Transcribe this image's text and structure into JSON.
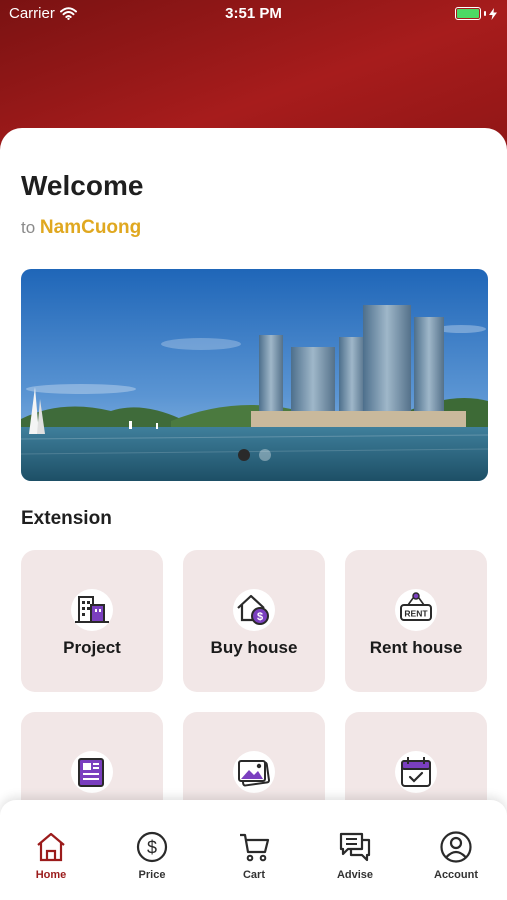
{
  "status_bar": {
    "carrier": "Carrier",
    "time": "3:51 PM"
  },
  "welcome": {
    "title": "Welcome",
    "prefix": "to",
    "brand": "NamCuong"
  },
  "banner": {
    "image": "coastal-towers-photo",
    "slide_count": 2,
    "active_slide": 1
  },
  "extension": {
    "title": "Extension",
    "tiles": [
      {
        "label": "Project",
        "icon": "building-icon"
      },
      {
        "label": "Buy house",
        "icon": "house-dollar-icon"
      },
      {
        "label": "Rent house",
        "icon": "rent-sign-icon"
      },
      {
        "label": "",
        "icon": "news-icon"
      },
      {
        "label": "",
        "icon": "gallery-icon"
      },
      {
        "label": "",
        "icon": "calendar-check-icon"
      }
    ]
  },
  "tabbar": {
    "tabs": [
      {
        "label": "Home",
        "icon": "home-icon",
        "active": true
      },
      {
        "label": "Price",
        "icon": "dollar-circle-icon",
        "active": false
      },
      {
        "label": "Cart",
        "icon": "cart-icon",
        "active": false
      },
      {
        "label": "Advise",
        "icon": "chat-icon",
        "active": false
      },
      {
        "label": "Account",
        "icon": "user-icon",
        "active": false
      }
    ]
  },
  "colors": {
    "header": "#9b1b1b",
    "brand": "#e0a820",
    "tile_bg": "#f2e7e7",
    "active_tab": "#9b1b1b",
    "icon_purple": "#7a3fbf"
  }
}
